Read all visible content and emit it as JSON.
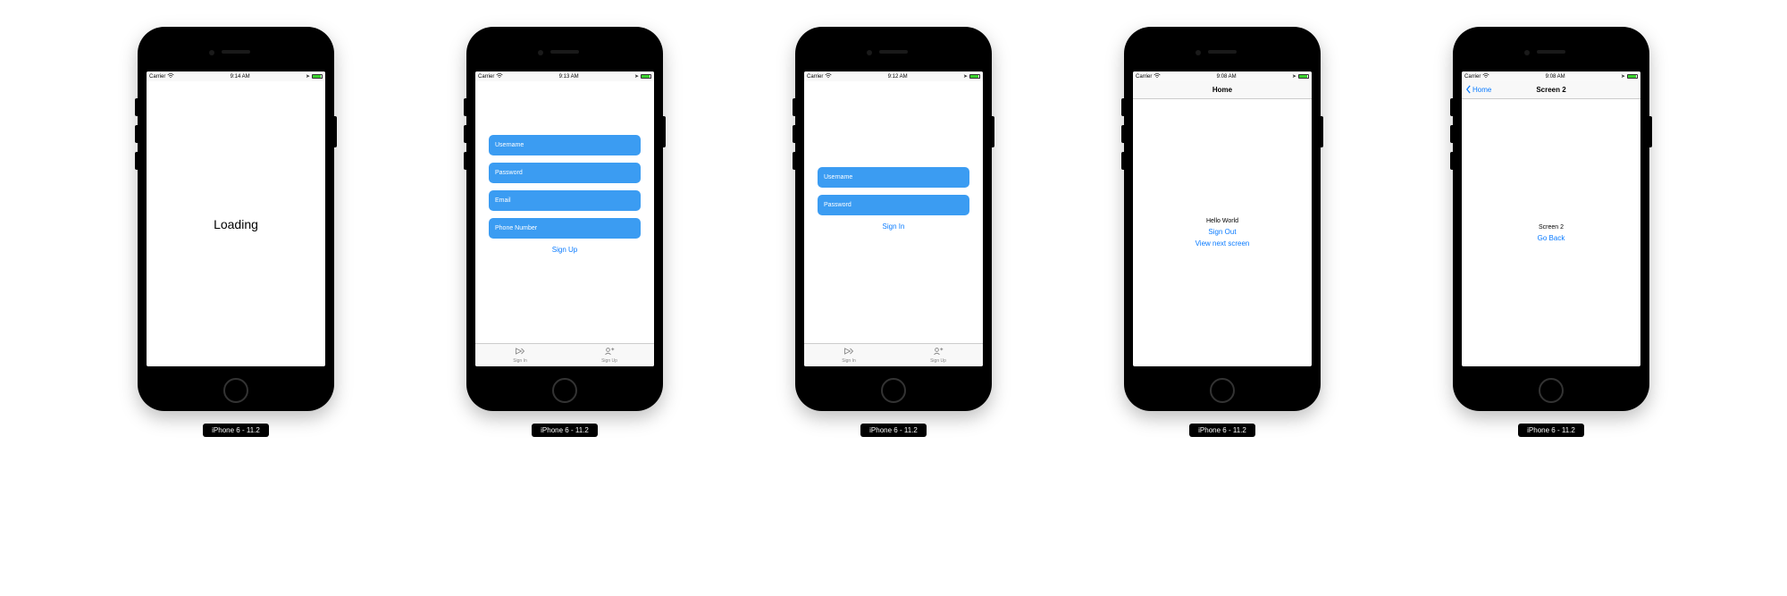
{
  "carrier": "Carrier",
  "sim_label": "iPhone 6 - 11.2",
  "screens": [
    {
      "time": "9:14 AM",
      "loading_text": "Loading"
    },
    {
      "time": "9:13 AM",
      "fields": [
        "Username",
        "Password",
        "Email",
        "Phone Number"
      ],
      "action": "Sign Up",
      "tabs": [
        "Sign In",
        "Sign Up"
      ]
    },
    {
      "time": "9:12 AM",
      "fields": [
        "Username",
        "Password"
      ],
      "action": "Sign In",
      "tabs": [
        "Sign In",
        "Sign Up"
      ]
    },
    {
      "time": "9:08 AM",
      "nav_title": "Home",
      "body": "Hello World",
      "sign_out": "Sign Out",
      "view_next": "View next screen"
    },
    {
      "time": "9:08 AM",
      "nav_title": "Screen 2",
      "back_label": "Home",
      "body": "Screen 2",
      "go_back": "Go Back"
    }
  ]
}
